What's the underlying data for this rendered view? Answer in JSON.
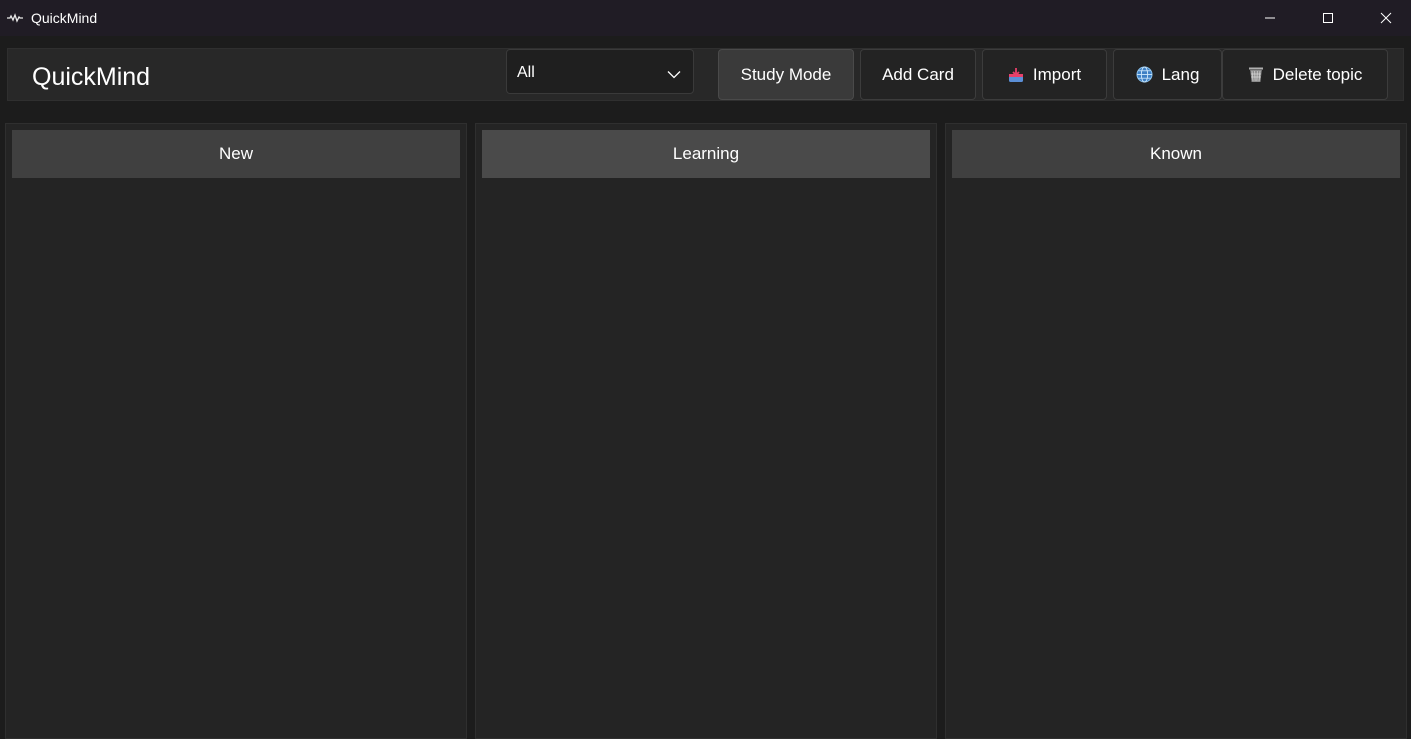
{
  "window": {
    "title": "QuickMind",
    "icon": "app-logo-icon",
    "controls": [
      "minimize-icon",
      "maximize-icon",
      "close-icon"
    ]
  },
  "toolbar": {
    "app_name": "QuickMind",
    "topic_filter": {
      "selected": "All",
      "icon": "chevron-down-icon"
    },
    "buttons": {
      "study_mode": "Study Mode",
      "add_card": "Add Card",
      "import": "Import",
      "lang": "Lang",
      "delete_topic": "Delete topic"
    },
    "icons": {
      "import": "inbox-tray-icon",
      "lang": "globe-icon",
      "delete_topic": "wastebasket-icon"
    }
  },
  "columns": [
    {
      "title": "New",
      "cards": []
    },
    {
      "title": "Learning",
      "cards": []
    },
    {
      "title": "Known",
      "cards": []
    }
  ],
  "colors": {
    "titlebar_bg": "#201c25",
    "app_bg": "#1c1c1c",
    "toolbar_bg": "#282828",
    "column_bg": "#242424",
    "column_header_bg": "#404040",
    "active_button_bg": "#3a3a3a"
  }
}
